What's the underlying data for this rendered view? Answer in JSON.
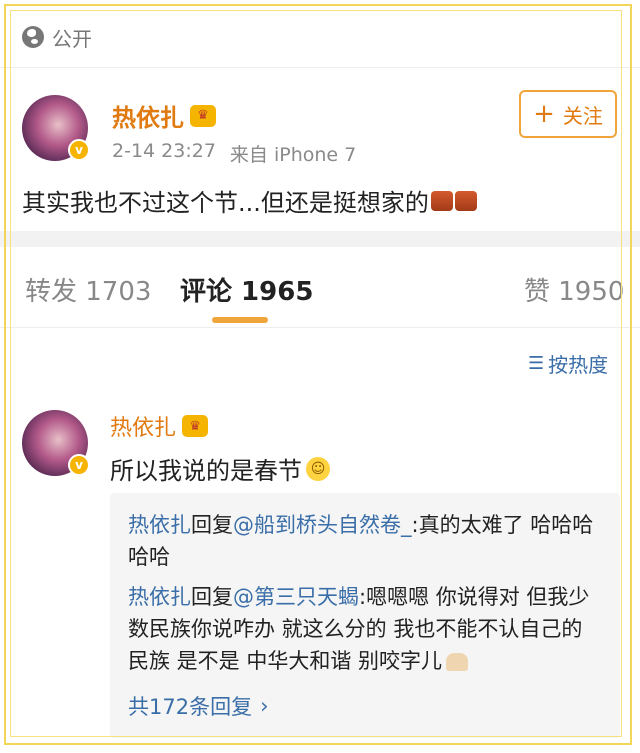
{
  "visibility": {
    "label": "公开",
    "icon": "globe-icon"
  },
  "post": {
    "author": "热依扎",
    "date": "2-14 23:27",
    "source": "来自 iPhone 7",
    "text": "其实我也不过这个节...但还是挺想家的",
    "follow_button": {
      "plus": "+",
      "label": "关注"
    },
    "verified_badge": "v"
  },
  "tabs": [
    {
      "label": "转发 1703"
    },
    {
      "label": "评论 1965",
      "active": true
    },
    {
      "label": "赞 1950"
    }
  ],
  "sort": {
    "icon": "sort-icon",
    "label": "按热度"
  },
  "comment": {
    "author": "热依扎",
    "text": "所以我说的是春节",
    "replies": [
      {
        "user": "热依扎",
        "verb": "回复",
        "mention": "@船到桥头自然卷_",
        "text": ":真的太难了 哈哈哈哈哈"
      },
      {
        "user": "热依扎",
        "verb": "回复",
        "mention": "@第三只天蝎",
        "text": ":嗯嗯嗯 你说得对 但我少数民族你说咋办 就这么分的 我也不能不认自己的民族 是不是 中华大和谐 别咬字儿"
      }
    ],
    "more_replies": "共172条回复",
    "more_arrow": "›"
  },
  "colors": {
    "accent": "#e07a11",
    "link": "#3a6ea8",
    "frame": "#f3d55a"
  }
}
